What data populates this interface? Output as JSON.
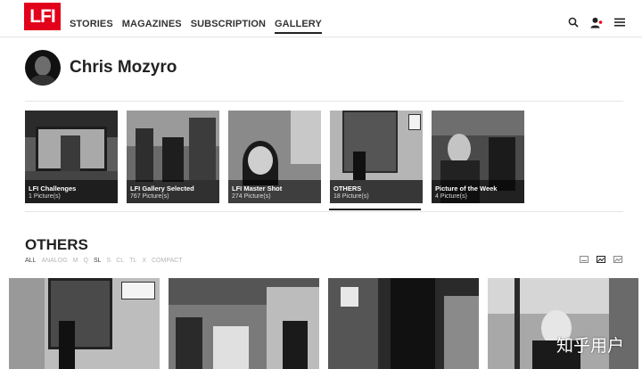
{
  "header": {
    "logo": "LFI",
    "nav": [
      "STORIES",
      "MAGAZINES",
      "SUBSCRIPTION",
      "GALLERY"
    ],
    "active_nav": "GALLERY",
    "icons": [
      "search-icon",
      "user-icon",
      "menu-icon"
    ]
  },
  "profile": {
    "name": "Chris Mozyro"
  },
  "galleries": [
    {
      "title": "LFI Challenges",
      "count": "1 Picture(s)"
    },
    {
      "title": "LFI Gallery Selected",
      "count": "767 Picture(s)"
    },
    {
      "title": "LFI Master Shot",
      "count": "274 Picture(s)"
    },
    {
      "title": "OTHERS",
      "count": "18 Picture(s)"
    },
    {
      "title": "Picture of the Week",
      "count": "4 Picture(s)"
    }
  ],
  "active_gallery": "OTHERS",
  "section": {
    "title": "OTHERS",
    "filters": [
      "ALL",
      "ANALOG",
      "M",
      "Q",
      "SL",
      "S",
      "CL",
      "TL",
      "X",
      "COMPACT"
    ],
    "active_filters": [
      "ALL",
      "SL"
    ],
    "view_icons": [
      "grid-small-icon",
      "grid-medium-icon",
      "grid-large-icon"
    ]
  },
  "watermark": "知乎用户",
  "colors": {
    "brand_red": "#e2001a",
    "text": "#222222",
    "muted": "#b5b5b5"
  }
}
